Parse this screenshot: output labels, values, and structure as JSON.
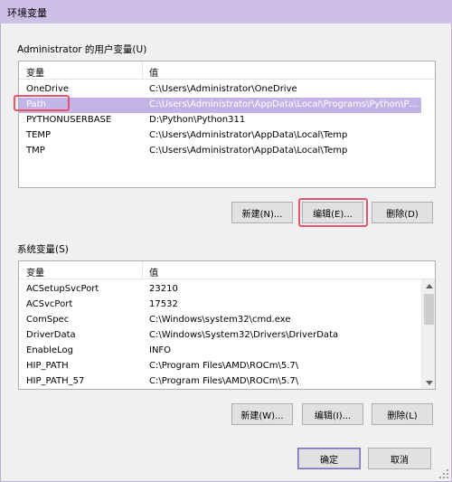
{
  "window": {
    "title": "环境变量"
  },
  "user_vars": {
    "group_label": "Administrator 的用户变量(U)",
    "columns": [
      "变量",
      "值"
    ],
    "rows": [
      {
        "name": "OneDrive",
        "value": "C:\\Users\\Administrator\\OneDrive"
      },
      {
        "name": "Path",
        "value": "C:\\Users\\Administrator\\AppData\\Local\\Programs\\Python\\Pyt..."
      },
      {
        "name": "PYTHONUSERBASE",
        "value": "D:\\Python\\Python311"
      },
      {
        "name": "TEMP",
        "value": "C:\\Users\\Administrator\\AppData\\Local\\Temp"
      },
      {
        "name": "TMP",
        "value": "C:\\Users\\Administrator\\AppData\\Local\\Temp"
      }
    ],
    "selected_index": 1,
    "buttons": {
      "new": "新建(N)...",
      "edit": "编辑(E)...",
      "delete": "删除(D)"
    }
  },
  "system_vars": {
    "group_label": "系统变量(S)",
    "columns": [
      "变量",
      "值"
    ],
    "rows": [
      {
        "name": "ACSetupSvcPort",
        "value": "23210"
      },
      {
        "name": "ACSvcPort",
        "value": "17532"
      },
      {
        "name": "ComSpec",
        "value": "C:\\Windows\\system32\\cmd.exe"
      },
      {
        "name": "DriverData",
        "value": "C:\\Windows\\System32\\Drivers\\DriverData"
      },
      {
        "name": "EnableLog",
        "value": "INFO"
      },
      {
        "name": "HIP_PATH",
        "value": "C:\\Program Files\\AMD\\ROCm\\5.7\\"
      },
      {
        "name": "HIP_PATH_57",
        "value": "C:\\Program Files\\AMD\\ROCm\\5.7\\"
      }
    ],
    "buttons": {
      "new": "新建(W)...",
      "edit": "编辑(I)...",
      "delete": "删除(L)"
    }
  },
  "dialog_buttons": {
    "ok": "确定",
    "cancel": "取消"
  },
  "icons": {
    "scroll_up": "chevron-up-icon",
    "scroll_down": "chevron-down-icon",
    "resize": "resize-grip-icon"
  },
  "colors": {
    "title_bar": "#cdbfe6",
    "selection": "#c2b4e6",
    "highlight": "#e9536c"
  }
}
